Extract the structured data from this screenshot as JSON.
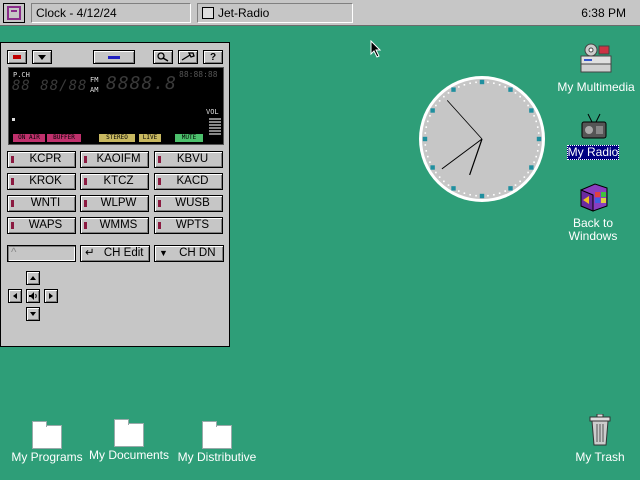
{
  "taskbar": {
    "start_icon": "app-menu-icon",
    "tasks": [
      {
        "label": "Clock - 4/12/24"
      },
      {
        "label": "Jet-Radio",
        "icon": "radio-icon"
      }
    ],
    "time": "6:38 PM"
  },
  "radio": {
    "display": {
      "pch_label": "P.CH",
      "fm_label": "FM",
      "am_label": "AM",
      "channel_digits": "88 88/88",
      "freq_digits": "8888.8",
      "clock_digits": "88:88:88",
      "vol_label": "VOL",
      "indicators": [
        "ON AIR",
        "BUFFER",
        "STEREO",
        "LIVE",
        "MUTE"
      ]
    },
    "stations": [
      "KCPR",
      "KAOIFM",
      "KBVU",
      "KROK",
      "KTCZ",
      "KACD",
      "WNTI",
      "WLPW",
      "WUSB",
      "WAPS",
      "WMMS",
      "WPTS"
    ],
    "ch_edit_label": "CH Edit",
    "ch_dn_label": "CH DN",
    "ch_edit_glyph": "↵",
    "ch_dn_glyph": "▼",
    "input_glyph": "^"
  },
  "clock": {
    "hour": 6,
    "minute": 38,
    "second": 53
  },
  "desktop": {
    "icons": [
      {
        "label": "My Multimedia",
        "icon": "multimedia-icon"
      },
      {
        "label": "My Radio",
        "icon": "radio-icon"
      },
      {
        "label": "Back to Windows",
        "icon": "back-to-windows-icon"
      },
      {
        "label": "My Programs",
        "icon": "folder-icon"
      },
      {
        "label": "My Documents",
        "icon": "folder-icon"
      },
      {
        "label": "My Distributive",
        "icon": "folder-icon"
      },
      {
        "label": "My Trash",
        "icon": "trash-icon"
      }
    ]
  },
  "colors": {
    "desktop": "#2e9e78",
    "panel": "#c6c6c6",
    "selection": "#000080",
    "indicator_onair": "#c0306c",
    "indicator_stereo": "#c8b860",
    "indicator_mute": "#4cc06c"
  }
}
